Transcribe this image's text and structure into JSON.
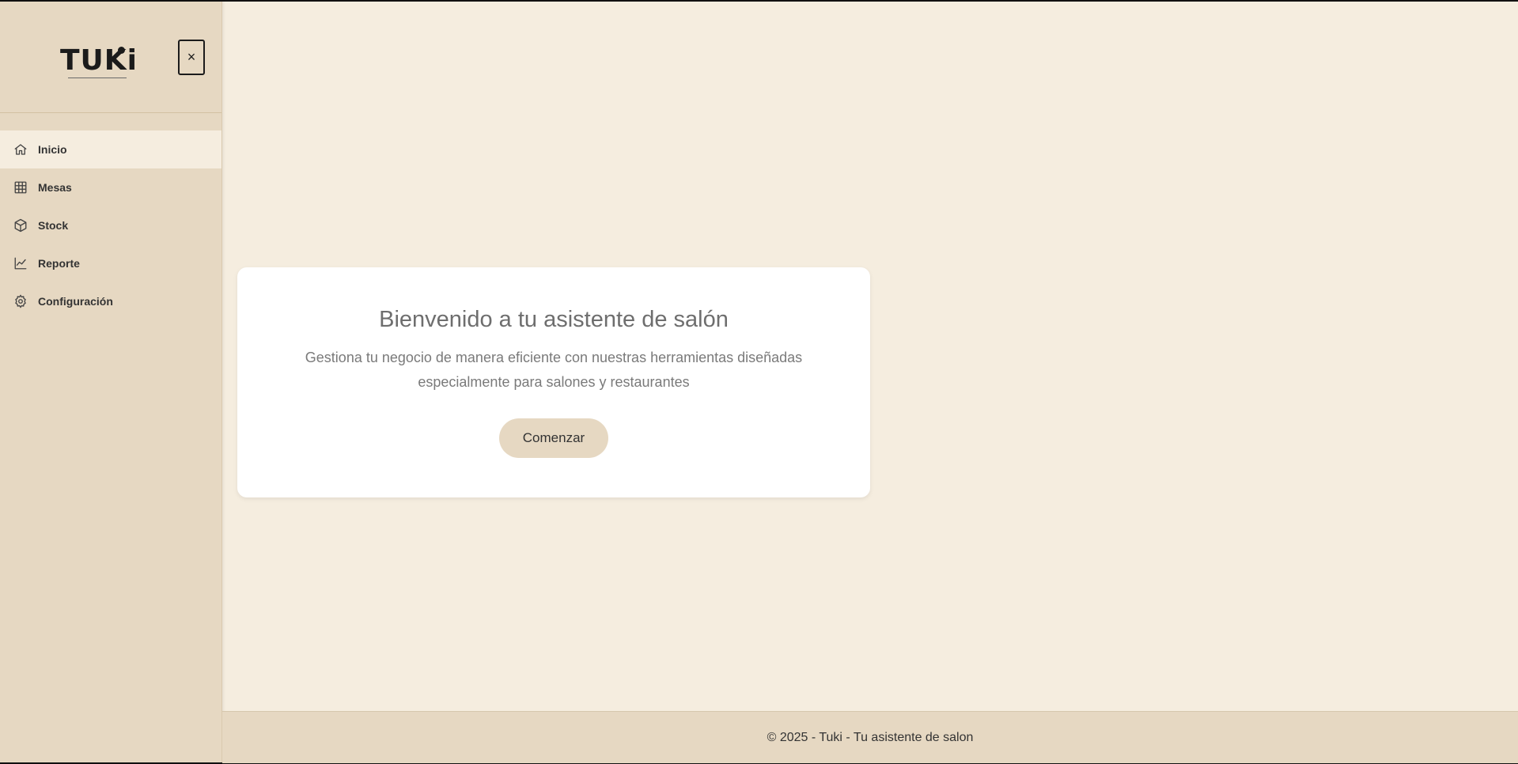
{
  "brand": {
    "logo_text": "TUKi"
  },
  "sidebar": {
    "close_label": "×",
    "items": [
      {
        "label": "Inicio",
        "icon": "home-icon",
        "active": true
      },
      {
        "label": "Mesas",
        "icon": "grid-icon",
        "active": false
      },
      {
        "label": "Stock",
        "icon": "box-icon",
        "active": false
      },
      {
        "label": "Reporte",
        "icon": "chart-line-icon",
        "active": false
      },
      {
        "label": "Configuración",
        "icon": "gear-icon",
        "active": false
      }
    ]
  },
  "main": {
    "title": "Bienvenido a tu asistente de salón",
    "description": "Gestiona tu negocio de manera eficiente con nuestras herramientas diseñadas especialmente para salones y restaurantes",
    "cta_label": "Comenzar"
  },
  "footer": {
    "text": "© 2025 - Tuki - Tu asistente de salon"
  },
  "colors": {
    "background": "#f5eddf",
    "sidebar": "#e6d8c2",
    "card": "#ffffff",
    "button": "#e6d8c2"
  }
}
